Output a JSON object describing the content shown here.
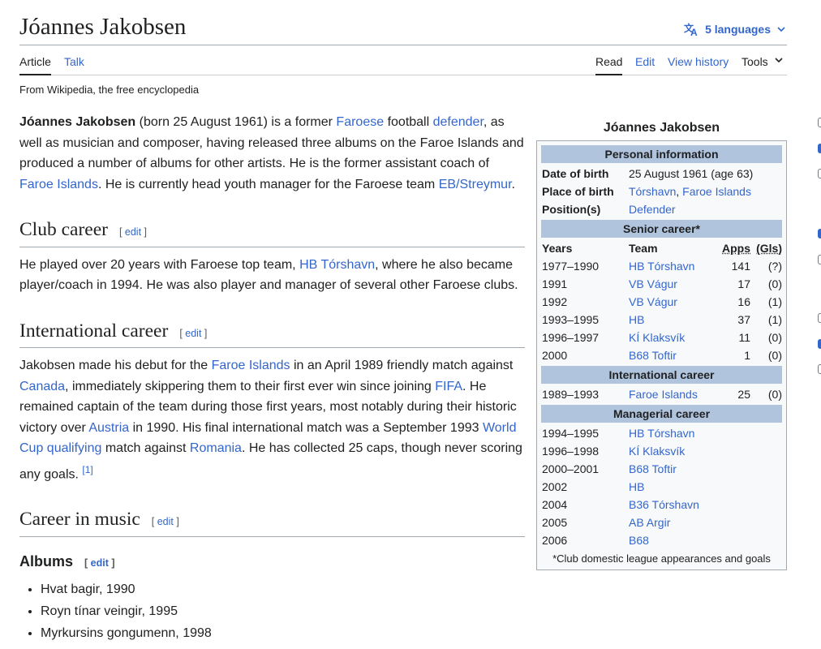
{
  "header": {
    "title": "Jóannes Jakobsen",
    "languages_label": "5 languages"
  },
  "tabs": {
    "article": "Article",
    "talk": "Talk",
    "read": "Read",
    "edit": "Edit",
    "view_history": "View history",
    "tools": "Tools"
  },
  "from_wikipedia": "From Wikipedia, the free encyclopedia",
  "intro": {
    "name": "Jóannes Jakobsen",
    "t1": " (born 25 August 1961) is a former ",
    "l1": "Faroese",
    "t2": " football ",
    "l2": "defender",
    "t3": ", as well as musician and composer, having released three albums on the Faroe Islands and produced a number of albums for other artists. He is the former assistant coach of ",
    "l3": "Faroe Islands",
    "t4": ". He is currently head youth manager for the Faroese team ",
    "l4": "EB/Streymur",
    "t5": "."
  },
  "edit_label": "edit",
  "club": {
    "heading": "Club career",
    "t1": "He played over 20 years with Faroese top team, ",
    "l1": "HB Tórshavn",
    "t2": ", where he also became player/coach in 1994. He was also player and manager of several other Faroese clubs."
  },
  "intl": {
    "heading": "International career",
    "t1": "Jakobsen made his debut for the ",
    "l1": "Faroe Islands",
    "t2": " in an April 1989 friendly match against ",
    "l2": "Canada",
    "t3": ", immediately skippering them to their first ever win since joining ",
    "l3": "FIFA",
    "t4": ". He remained captain of the team during those first years, most notably during their historic victory over ",
    "l4": "Austria",
    "t5": " in 1990. His final international match was a September 1993 ",
    "l5": "World Cup qualifying",
    "t6": " match against ",
    "l6": "Romania",
    "t7": ". He has collected 25 caps, though never scoring any goals. ",
    "ref": "[1]"
  },
  "music": {
    "heading": "Career in music",
    "albums_heading": "Albums",
    "albums": [
      "Hvat bagir, 1990",
      "Royn tínar veingir, 1995",
      "Myrkursins gongumenn, 1998"
    ]
  },
  "infobox": {
    "caption": "Jóannes Jakobsen",
    "personal_head": "Personal information",
    "dob_label": "Date of birth",
    "dob_value": "25 August 1961 (age 63)",
    "pob_label": "Place of birth",
    "pob_city": "Tórshavn",
    "pob_sep": ", ",
    "pob_country": "Faroe Islands",
    "pos_label": "Position(s)",
    "pos_value": "Defender",
    "senior_head": "Senior career*",
    "col_years": "Years",
    "col_team": "Team",
    "col_apps": "Apps",
    "col_gls": "(Gls)",
    "senior": [
      {
        "years": "1977–1990",
        "team": "HB Tórshavn",
        "apps": "141",
        "gls": "(?)"
      },
      {
        "years": "1991",
        "team": "VB Vágur",
        "apps": "17",
        "gls": "(0)"
      },
      {
        "years": "1992",
        "team": "VB Vágur",
        "apps": "16",
        "gls": "(1)"
      },
      {
        "years": "1993–1995",
        "team": "HB",
        "apps": "37",
        "gls": "(1)"
      },
      {
        "years": "1996–1997",
        "team": "KÍ Klaksvík",
        "apps": "11",
        "gls": "(0)"
      },
      {
        "years": "2000",
        "team": "B68 Toftir",
        "apps": "1",
        "gls": "(0)"
      }
    ],
    "intl_head": "International career",
    "intl": [
      {
        "years": "1989–1993",
        "team": "Faroe Islands",
        "apps": "25",
        "gls": "(0)"
      }
    ],
    "manager_head": "Managerial career",
    "manager": [
      {
        "years": "1994–1995",
        "team": "HB Tórshavn"
      },
      {
        "years": "1996–1998",
        "team": "KÍ Klaksvík"
      },
      {
        "years": "2000–2001",
        "team": "B68 Toftir"
      },
      {
        "years": "2002",
        "team": "HB"
      },
      {
        "years": "2004",
        "team": "B36 Tórshavn"
      },
      {
        "years": "2005",
        "team": "AB Argir"
      },
      {
        "years": "2006",
        "team": "B68"
      }
    ],
    "footnote": "*Club domestic league appearances and goals"
  }
}
